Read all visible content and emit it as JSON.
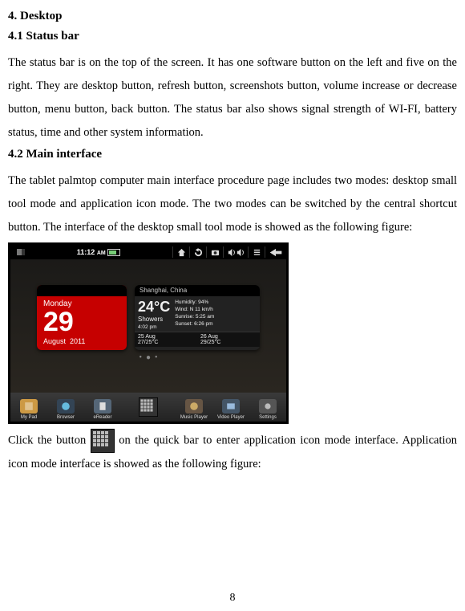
{
  "section": {
    "heading": "4. Desktop"
  },
  "s41": {
    "heading": "4.1 Status bar",
    "text": "The status bar is on the top of the screen. It has one software button on the left and five on the right. They are desktop button, refresh button, screenshots button, volume increase or decrease button, menu button, back button. The status bar also shows signal strength of WI-FI, battery status, time and other system information."
  },
  "s42": {
    "heading": "4.2 Main interface",
    "text": "The tablet palmtop computer main interface procedure page includes two modes: desktop small tool mode and application icon mode. The two modes can be switched by the central shortcut button. The interface of the desktop small tool mode is showed as the following figure:"
  },
  "after": {
    "click_pre": "Click the button ",
    "click_post": " on the quick bar to enter application icon mode interface. Application icon mode interface is showed as the following figure:"
  },
  "screenshot": {
    "time": "11:12",
    "ampm": "AM",
    "status_icons": [
      "home-icon",
      "refresh-icon",
      "camera-icon",
      "volume-icon",
      "menu-icon",
      "back-icon"
    ],
    "calendar": {
      "dayname": "Monday",
      "daynum": "29",
      "month": "August",
      "year": "2011"
    },
    "weather": {
      "city": "Shanghai, China",
      "temp": "24°C",
      "cond": "Showers",
      "humidity": "Humidity: 94%",
      "wind": "Wind: N  11 km/h",
      "sunrise": "Sunrise:  5:25 am",
      "sunset": "Sunset:   6:26 pm",
      "local": "4:02 pm",
      "f1_date": "25 Aug",
      "f1_temp": "27/25°C",
      "f2_date": "26 Aug",
      "f2_temp": "29/25°C"
    },
    "dock": {
      "left": [
        {
          "name": "mypad",
          "label": "My Pad"
        },
        {
          "name": "browser",
          "label": "Browser"
        },
        {
          "name": "ereader",
          "label": "eReader"
        }
      ],
      "right": [
        {
          "name": "music",
          "label": "Music Player"
        },
        {
          "name": "video",
          "label": "Video Player"
        },
        {
          "name": "settings",
          "label": "Settings"
        }
      ]
    }
  },
  "page_number": "8"
}
